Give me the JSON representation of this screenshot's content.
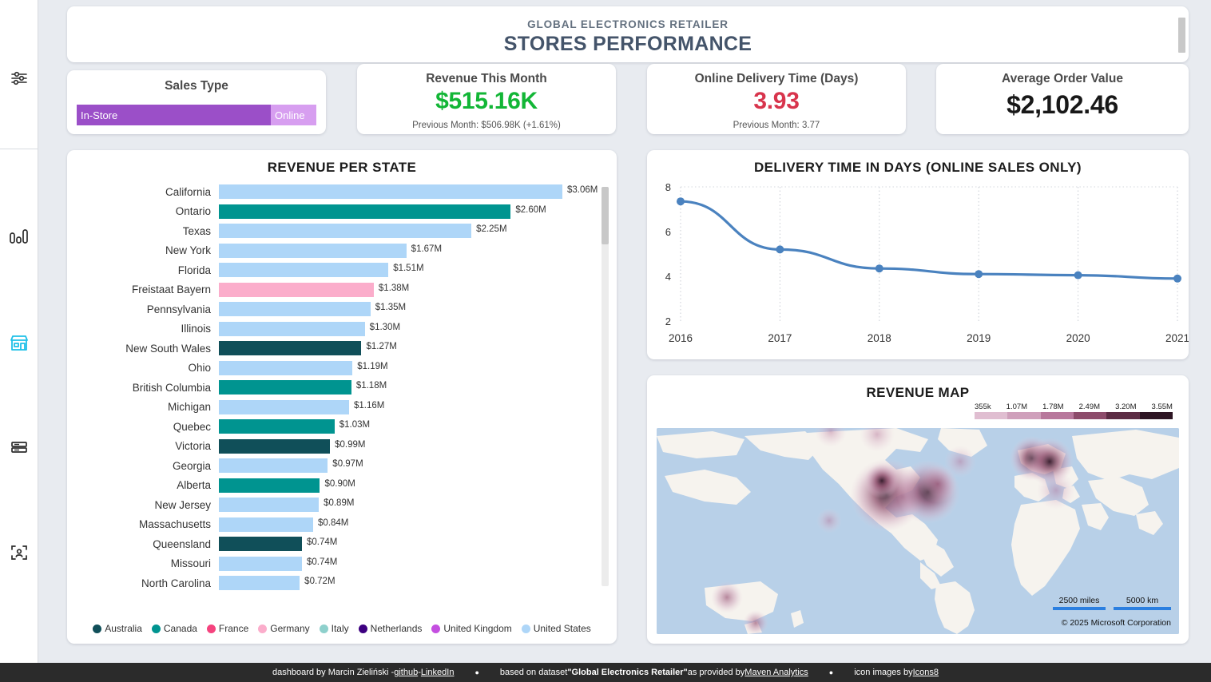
{
  "sidebar": {
    "items": [
      {
        "name": "filters-icon",
        "label": "Filters",
        "active": false
      },
      {
        "name": "bar-chart-icon",
        "label": "Overview",
        "active": false
      },
      {
        "name": "store-icon",
        "label": "Stores Performance",
        "active": true
      },
      {
        "name": "database-icon",
        "label": "Data",
        "active": false
      },
      {
        "name": "customer-scan-icon",
        "label": "Customers",
        "active": false
      }
    ]
  },
  "header": {
    "subtitle": "GLOBAL ELECTRONICS RETAILER",
    "title": "STORES PERFORMANCE"
  },
  "slicer": {
    "title": "Sales Type",
    "options": [
      {
        "label": "In-Store",
        "share": 81,
        "color": "#9b4fc8",
        "selected": true
      },
      {
        "label": "Online",
        "share": 19,
        "color": "#d79ef0",
        "selected": false
      }
    ]
  },
  "kpis": [
    {
      "name": "revenue-this-month",
      "title": "Revenue This Month",
      "value": "$515.16K",
      "value_color": "#12b636",
      "subtitle": "Previous Month: $506.98K (+1.61%)"
    },
    {
      "name": "online-delivery-time",
      "title": "Online Delivery Time (Days)",
      "value": "3.93",
      "value_color": "#d8344c",
      "subtitle": "Previous Month: 3.77"
    },
    {
      "name": "average-order-value",
      "title": "Average Order Value",
      "value": "$2,102.46",
      "value_color": "#181818",
      "subtitle": ""
    }
  ],
  "revenue_per_state": {
    "title": "REVENUE PER STATE",
    "legend": [
      {
        "label": "Australia",
        "color": "#104f59"
      },
      {
        "label": "Canada",
        "color": "#009490"
      },
      {
        "label": "France",
        "color": "#f5437e"
      },
      {
        "label": "Germany",
        "color": "#fbadcb"
      },
      {
        "label": "Italy",
        "color": "#8ed0cc"
      },
      {
        "label": "Netherlands",
        "color": "#3d0080"
      },
      {
        "label": "United Kingdom",
        "color": "#c44fe0"
      },
      {
        "label": "United States",
        "color": "#aed6f8"
      }
    ]
  },
  "delivery_chart": {
    "title": "DELIVERY TIME IN DAYS (ONLINE SALES ONLY)"
  },
  "revenue_map": {
    "title": "REVENUE MAP",
    "legend_labels": [
      "355k",
      "1.07M",
      "1.78M",
      "2.49M",
      "3.20M",
      "3.55M"
    ],
    "legend_colors": [
      "#e0bed1",
      "#cfa0bb",
      "#b8789c",
      "#8d4c6b",
      "#5c2c44",
      "#2e1624"
    ],
    "scale_miles": "2500 miles",
    "scale_km": "5000 km",
    "credit": "© 2025 Microsoft Corporation"
  },
  "footer": {
    "author_prefix": "dashboard by Marcin Zieliński - ",
    "github": "github",
    "sep1": " - ",
    "linkedin": "LinkedIn",
    "dot": "●",
    "dataset_prefix": "based on dataset ",
    "dataset_name": "\"Global Electronics Retailer\"",
    "dataset_mid": " as provided by ",
    "dataset_source": "Maven Analytics",
    "icons_prefix": "icon images by ",
    "icons_source": "Icons8"
  },
  "chart_data": [
    {
      "type": "bar",
      "orientation": "horizontal",
      "title": "REVENUE PER STATE",
      "xlabel": "",
      "ylabel": "",
      "value_format": "$#.##M",
      "xlim": [
        0,
        3.06
      ],
      "categories": [
        "California",
        "Ontario",
        "Texas",
        "New York",
        "Florida",
        "Freistaat Bayern",
        "Pennsylvania",
        "Illinois",
        "New South Wales",
        "Ohio",
        "British Columbia",
        "Michigan",
        "Quebec",
        "Victoria",
        "Georgia",
        "Alberta",
        "New Jersey",
        "Massachusetts",
        "Queensland",
        "Missouri",
        "North Carolina"
      ],
      "values": [
        3.06,
        2.6,
        2.25,
        1.67,
        1.51,
        1.38,
        1.35,
        1.3,
        1.27,
        1.19,
        1.18,
        1.16,
        1.03,
        0.99,
        0.97,
        0.9,
        0.89,
        0.84,
        0.74,
        0.74,
        0.72
      ],
      "labels": [
        "$3.06M",
        "$2.60M",
        "$2.25M",
        "$1.67M",
        "$1.51M",
        "$1.38M",
        "$1.35M",
        "$1.30M",
        "$1.27M",
        "$1.19M",
        "$1.18M",
        "$1.16M",
        "$1.03M",
        "$0.99M",
        "$0.97M",
        "$0.90M",
        "$0.89M",
        "$0.84M",
        "$0.74M",
        "$0.74M",
        "$0.72M"
      ],
      "countries": [
        "United States",
        "Canada",
        "United States",
        "United States",
        "United States",
        "Germany",
        "United States",
        "United States",
        "Australia",
        "United States",
        "Canada",
        "United States",
        "Canada",
        "Australia",
        "United States",
        "Canada",
        "United States",
        "United States",
        "Australia",
        "United States",
        "United States"
      ],
      "colors": [
        "#aed6f8",
        "#009490",
        "#aed6f8",
        "#aed6f8",
        "#aed6f8",
        "#fbadcb",
        "#aed6f8",
        "#aed6f8",
        "#104f59",
        "#aed6f8",
        "#009490",
        "#aed6f8",
        "#009490",
        "#104f59",
        "#aed6f8",
        "#009490",
        "#aed6f8",
        "#aed6f8",
        "#104f59",
        "#aed6f8",
        "#aed6f8"
      ],
      "legend": [
        "Australia",
        "Canada",
        "France",
        "Germany",
        "Italy",
        "Netherlands",
        "United Kingdom",
        "United States"
      ],
      "legend_position": "bottom",
      "grid": false
    },
    {
      "type": "line",
      "title": "DELIVERY TIME IN DAYS (ONLINE SALES ONLY)",
      "xlabel": "",
      "ylabel": "",
      "x": [
        "2016",
        "2017",
        "2018",
        "2019",
        "2020",
        "2021"
      ],
      "values": [
        7.35,
        5.2,
        4.35,
        4.1,
        4.05,
        3.9
      ],
      "ylim": [
        2,
        8
      ],
      "yticks": [
        2,
        4,
        6,
        8
      ],
      "grid": true,
      "line_color": "#4a82bf",
      "marker": "circle",
      "legend_position": "none"
    },
    {
      "type": "heatmap",
      "title": "REVENUE MAP",
      "subtype": "geo-density",
      "legend_labels": [
        "355k",
        "1.07M",
        "1.78M",
        "2.49M",
        "3.20M",
        "3.55M"
      ],
      "legend_position": "top-right",
      "hotspots": [
        {
          "region": "United States West",
          "intensity": 0.75
        },
        {
          "region": "United States East",
          "intensity": 0.95
        },
        {
          "region": "Canada Ontario",
          "intensity": 0.7
        },
        {
          "region": "United Kingdom",
          "intensity": 1.0
        },
        {
          "region": "Germany",
          "intensity": 1.0
        },
        {
          "region": "Italy",
          "intensity": 0.5
        },
        {
          "region": "Australia",
          "intensity": 0.45
        }
      ]
    }
  ]
}
